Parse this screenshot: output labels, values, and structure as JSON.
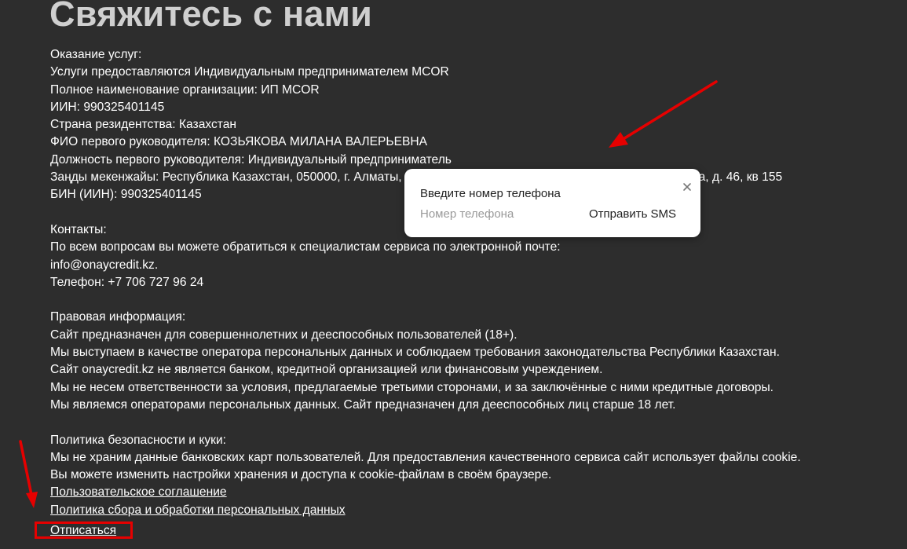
{
  "page_title": "Свяжитесь с нами",
  "services": {
    "heading": "Оказание услуг:",
    "lines": [
      "Услуги предоставляются Индивидуальным предпринимателем MCOR",
      "Полное наименование организации: ИП MCOR",
      "ИИН: 990325401145",
      "Страна резидентства: Казахстан",
      "ФИО первого руководителя: КОЗЬЯКОВА МИЛАНА ВАЛЕРЬЕВНА",
      "Должность первого руководителя: Индивидуальный предприниматель",
      "Заңды мекенжайы: Республика Казахстан, 050000, г. Алматы, Бостандыкский район, ул. Тлендиева/Ташкемпирова, д. 46, кв 155",
      "БИН (ИИН): 990325401145"
    ]
  },
  "contacts": {
    "heading": "Контакты:",
    "lines": [
      "По всем вопросам вы можете обратиться к специалистам сервиса по электронной почте:",
      "info@onaycredit.kz.",
      "Телефон: +7 706 727 96 24"
    ]
  },
  "legal": {
    "heading": "Правовая информация:",
    "lines": [
      "Сайт предназначен для совершеннолетних и дееспособных пользователей (18+).",
      "Мы выступаем в качестве оператора персональных данных и соблюдаем требования законодательства Республики Казахстан.",
      "Сайт onaycredit.kz не является банком, кредитной организацией или финансовым учреждением.",
      "Мы не несем ответственности за условия, предлагаемые третьими сторонами, и за заключённые с ними кредитные договоры.",
      "Мы являемся операторами персональных данных. Сайт предназначен для дееспособных лиц старше 18 лет."
    ]
  },
  "security": {
    "heading": "Политика безопасности и куки:",
    "lines": [
      "Мы не храним данные банковских карт пользователей. Для предоставления качественного сервиса сайт использует файлы cookie.",
      "Вы можете изменить настройки хранения и доступа к cookie-файлам в своём браузере."
    ],
    "links": [
      "Пользовательское соглашение",
      "Политика сбора и обработки персональных данных"
    ],
    "unsubscribe": "Отписаться"
  },
  "popup": {
    "title": "Введите номер телефона",
    "phone_placeholder": "Номер телефона",
    "phone_value": "",
    "send_label": "Отправить SMS",
    "close_icon": "close-icon"
  },
  "colors": {
    "background": "#2d2d2d",
    "annotation": "#e60000",
    "title": "#cfcfcf"
  }
}
